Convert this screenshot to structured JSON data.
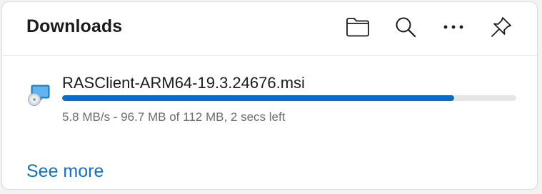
{
  "header": {
    "title": "Downloads",
    "buttons": [
      {
        "icon": "folder-icon",
        "action": "open-downloads-folder"
      },
      {
        "icon": "search-icon",
        "action": "search-downloads"
      },
      {
        "icon": "more-icon",
        "action": "more-options"
      },
      {
        "icon": "pin-icon",
        "action": "pin-downloads"
      }
    ]
  },
  "download": {
    "file_name": "RASClient-ARM64-19.3.24676.msi",
    "status": "5.8 MB/s - 96.7 MB of 112 MB, 2 secs left",
    "progress": 0.863,
    "icon": "installer-package-icon"
  },
  "footer": {
    "see_more": "See more"
  },
  "colors": {
    "accent": "#0a6cc4",
    "link": "#1170c9",
    "track": "#e6e6e6",
    "muted_text": "#6b6b6b"
  }
}
